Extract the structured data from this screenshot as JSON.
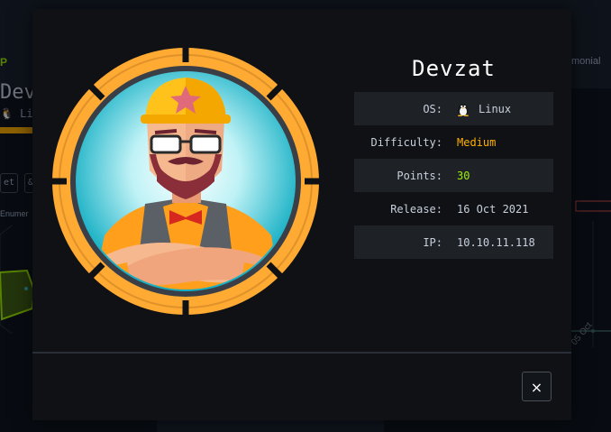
{
  "background": {
    "tag": "P",
    "title": "Devz",
    "os_label": "Li",
    "buttons": [
      "et",
      "&"
    ],
    "enum_label": "Enumer",
    "right_text": "monial",
    "graph_date": "05 Oct"
  },
  "modal": {
    "title": "Devzat",
    "rows": [
      {
        "label": "OS:",
        "value": "Linux",
        "icon": "linux-tux-icon",
        "color": "#c8d0dc"
      },
      {
        "label": "Difficulty:",
        "value": "Medium",
        "color": "#ffaf00"
      },
      {
        "label": "Points:",
        "value": "30",
        "color": "#9fef00"
      },
      {
        "label": "Release:",
        "value": "16 Oct 2021",
        "color": "#c8d0dc"
      },
      {
        "label": "IP:",
        "value": "10.10.11.118",
        "color": "#c8d0dc"
      }
    ],
    "close_label": "×"
  },
  "colors": {
    "medium": "#ffaf00",
    "points": "#9fef00",
    "avatar_ring": "#ffaa33"
  }
}
